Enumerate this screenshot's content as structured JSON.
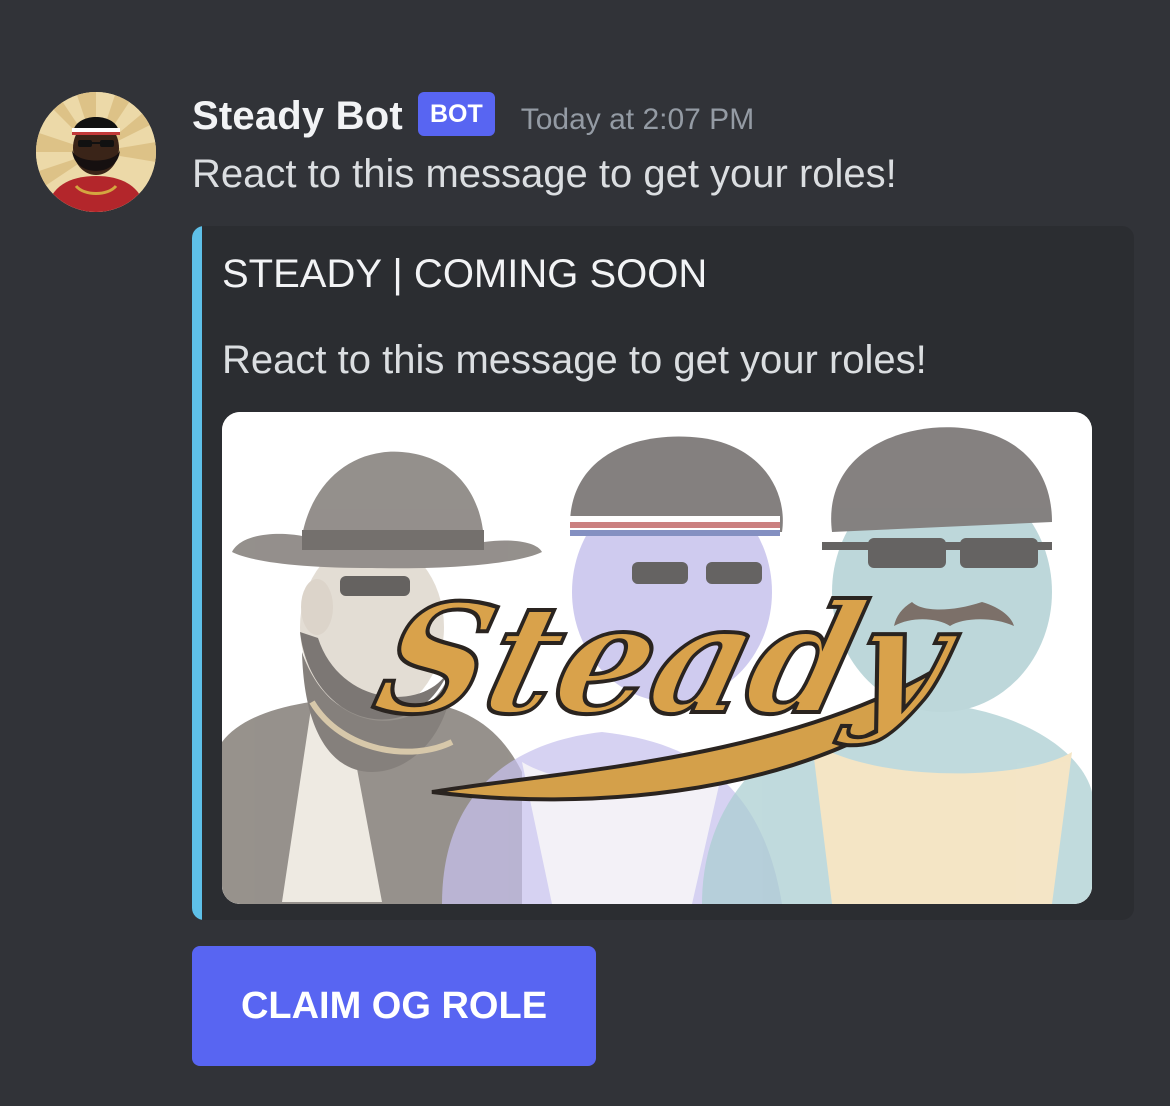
{
  "message": {
    "author": "Steady Bot",
    "bot_tag": "BOT",
    "timestamp": "Today at 2:07 PM",
    "content": "React to this message to get your roles!"
  },
  "embed": {
    "accent_color": "#5ec0e8",
    "title": "STEADY | COMING SOON",
    "description": "React to this message to get your roles!",
    "image_logo_text": "Steady"
  },
  "components": {
    "claim_button_label": "CLAIM OG ROLE",
    "claim_button_color": "#5865f2"
  }
}
